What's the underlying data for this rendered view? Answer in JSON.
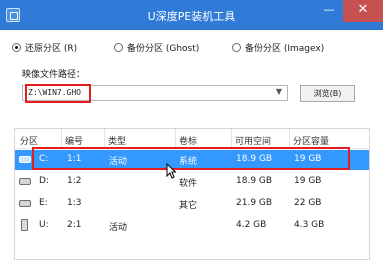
{
  "window": {
    "title": "U深度PE装机工具",
    "minimize_glyph": "—",
    "close_glyph": "✕"
  },
  "options": {
    "restore": "还原分区 (R)",
    "backup": "备份分区 (Ghost)",
    "backup_imagex": "备份分区 (Imagex)",
    "selected": "restore"
  },
  "image_path": {
    "label": "映像文件路径：",
    "value": "Z:\\WIN7.GHO",
    "browse": "浏览(B)"
  },
  "table": {
    "headers": [
      "分区",
      "编号",
      "类型",
      "卷标",
      "可用空间",
      "分区容量"
    ],
    "rows": [
      {
        "partition": "C:",
        "number": "1:1",
        "type": "活动",
        "label": "系统",
        "free": "18.9 GB",
        "size": "19 GB",
        "selected": true
      },
      {
        "partition": "D:",
        "number": "1:2",
        "type": "",
        "label": "软件",
        "free": "18.9 GB",
        "size": "19 GB",
        "selected": false
      },
      {
        "partition": "E:",
        "number": "1:3",
        "type": "",
        "label": "其它",
        "free": "21.9 GB",
        "size": "22 GB",
        "selected": false
      },
      {
        "partition": "U:",
        "number": "2:1",
        "type": "活动",
        "label": "",
        "free": "4.2 GB",
        "size": "4.3 GB",
        "selected": false
      }
    ]
  },
  "colors": {
    "titlebar": "#2f7bd7",
    "selection": "#3399ff",
    "highlight": "#e02020"
  }
}
